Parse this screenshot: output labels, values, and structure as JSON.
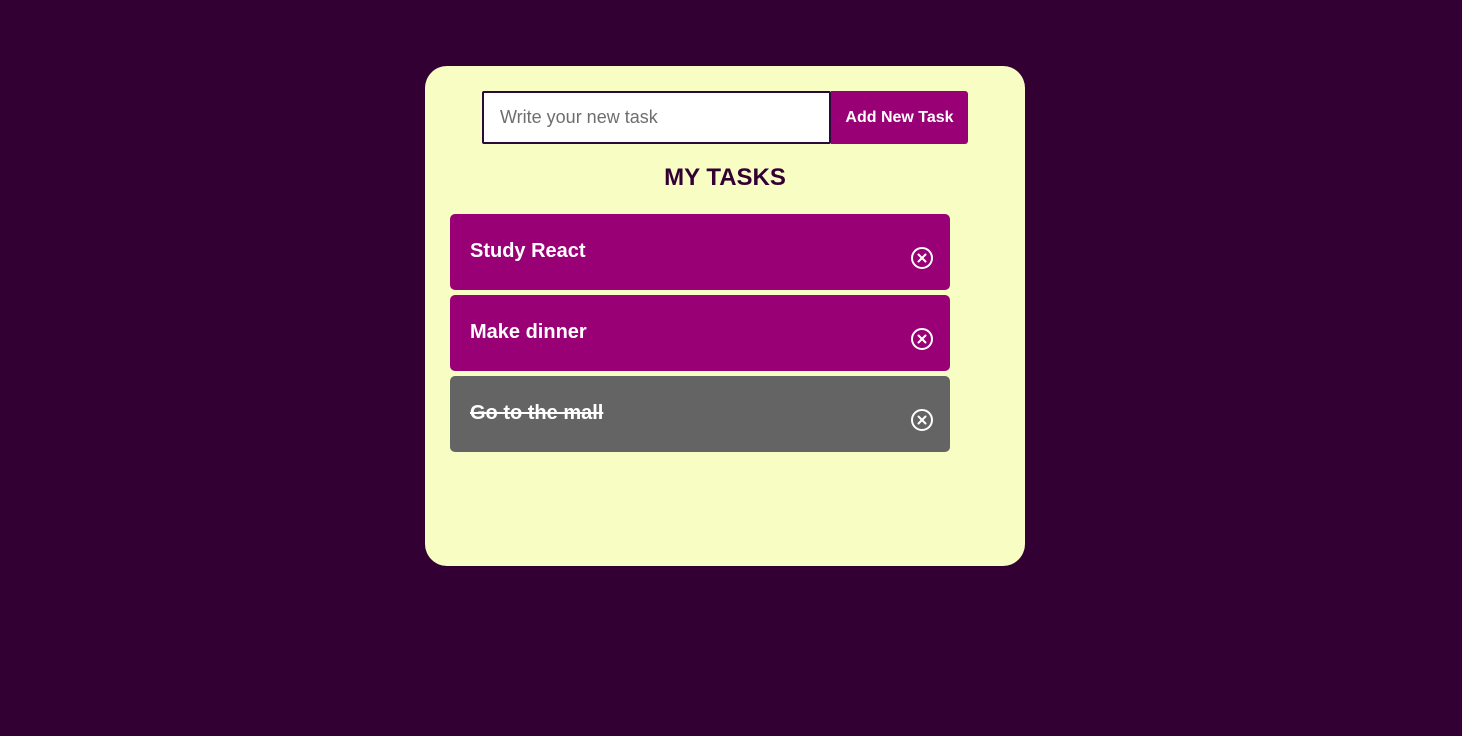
{
  "form": {
    "input_placeholder": "Write your new task",
    "input_value": "",
    "add_button_label": "Add New Task"
  },
  "heading": "MY TASKS",
  "tasks": [
    {
      "text": "Study React",
      "completed": false,
      "delete_icon": "circle-x-icon"
    },
    {
      "text": "Make dinner",
      "completed": false,
      "delete_icon": "circle-x-icon"
    },
    {
      "text": "Go to the mall",
      "completed": true,
      "delete_icon": "circle-x-icon"
    }
  ],
  "colors": {
    "page_background": "#330033",
    "card_background": "#f7fdc3",
    "accent": "#990075",
    "completed_task": "#646464",
    "heading_text": "#330033"
  }
}
